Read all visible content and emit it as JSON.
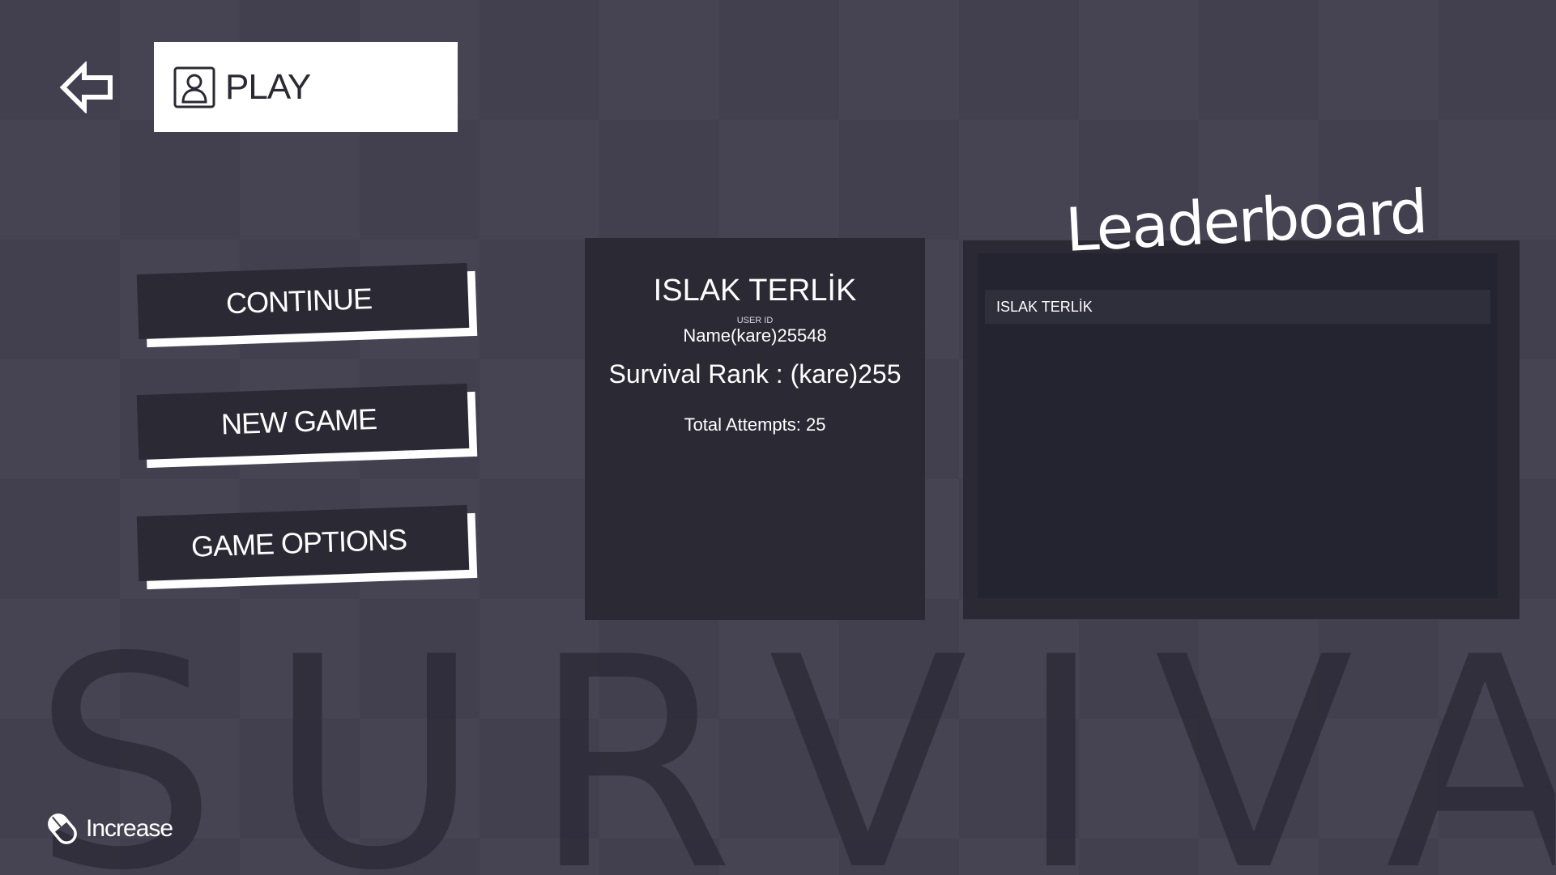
{
  "background": {
    "word": "SURVIVAL"
  },
  "header": {
    "back_icon": "arrow-left-icon",
    "profile_icon": "user-profile-icon",
    "title": "PLAY"
  },
  "menu": {
    "items": [
      {
        "label": "CONTINUE"
      },
      {
        "label": "NEW GAME"
      },
      {
        "label": "GAME OPTIONS"
      }
    ]
  },
  "player": {
    "name": "ISLAK TERLİK",
    "user_id_label": "USER ID",
    "user_id_value": "Name(kare)25548",
    "rank_text": "Survival Rank : (kare)255",
    "attempts_text": "Total Attempts: 25"
  },
  "leaderboard": {
    "title": "Leaderboard",
    "entries": [
      {
        "name": "ISLAK TERLİK"
      }
    ]
  },
  "hint": {
    "icon": "mouse-scroll-icon",
    "label": "Increase"
  },
  "colors": {
    "background": "#42404f",
    "panel": "#2a2934",
    "text": "#ffffff",
    "accent_white": "#ffffff"
  }
}
